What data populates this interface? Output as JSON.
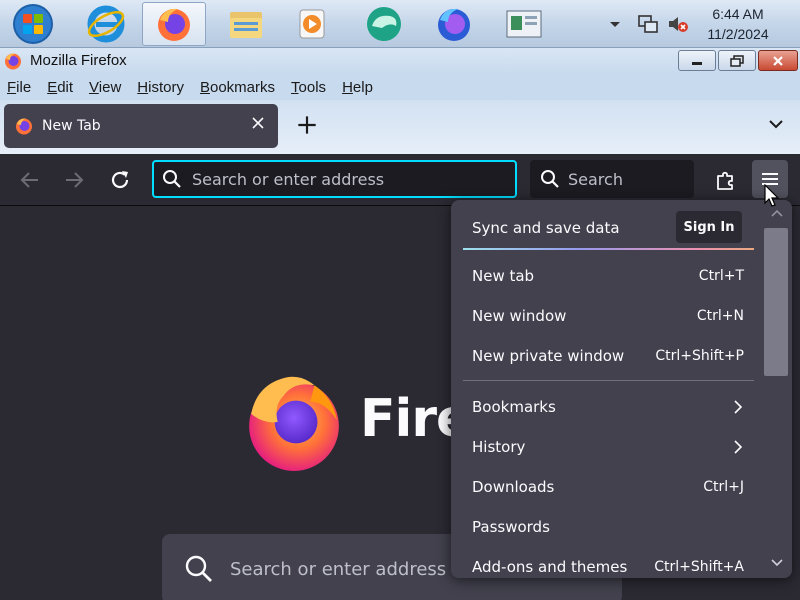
{
  "taskbar": {
    "clock_time": "6:44 AM",
    "clock_date": "11/2/2024",
    "apps": [
      "internet-explorer-icon",
      "firefox-icon",
      "file-explorer-icon",
      "media-player-icon",
      "chat-app-icon",
      "firefox-nightly-icon",
      "window-app-icon"
    ]
  },
  "window": {
    "title": "Mozilla Firefox"
  },
  "menubar": {
    "items": [
      "File",
      "Edit",
      "View",
      "History",
      "Bookmarks",
      "Tools",
      "Help"
    ]
  },
  "tabs": [
    {
      "label": "New Tab"
    }
  ],
  "navbar": {
    "url_placeholder": "Search or enter address",
    "search_placeholder": "Search"
  },
  "content": {
    "wordmark": "Firefox",
    "search_placeholder": "Search or enter address"
  },
  "appmenu": {
    "sync_label": "Sync and save data",
    "signin_label": "Sign In",
    "items": [
      {
        "label": "New tab",
        "shortcut": "Ctrl+T"
      },
      {
        "label": "New window",
        "shortcut": "Ctrl+N"
      },
      {
        "label": "New private window",
        "shortcut": "Ctrl+Shift+P"
      },
      {
        "label": "Bookmarks",
        "shortcut": ""
      },
      {
        "label": "History",
        "shortcut": ""
      },
      {
        "label": "Downloads",
        "shortcut": "Ctrl+J"
      },
      {
        "label": "Passwords",
        "shortcut": ""
      },
      {
        "label": "Add-ons and themes",
        "shortcut": "Ctrl+Shift+A"
      }
    ]
  },
  "colors": {
    "accent_focus": "#00ddff",
    "toolbar_bg": "#2b2a33",
    "panel_bg": "#42414d",
    "text": "#fbfbfe"
  }
}
